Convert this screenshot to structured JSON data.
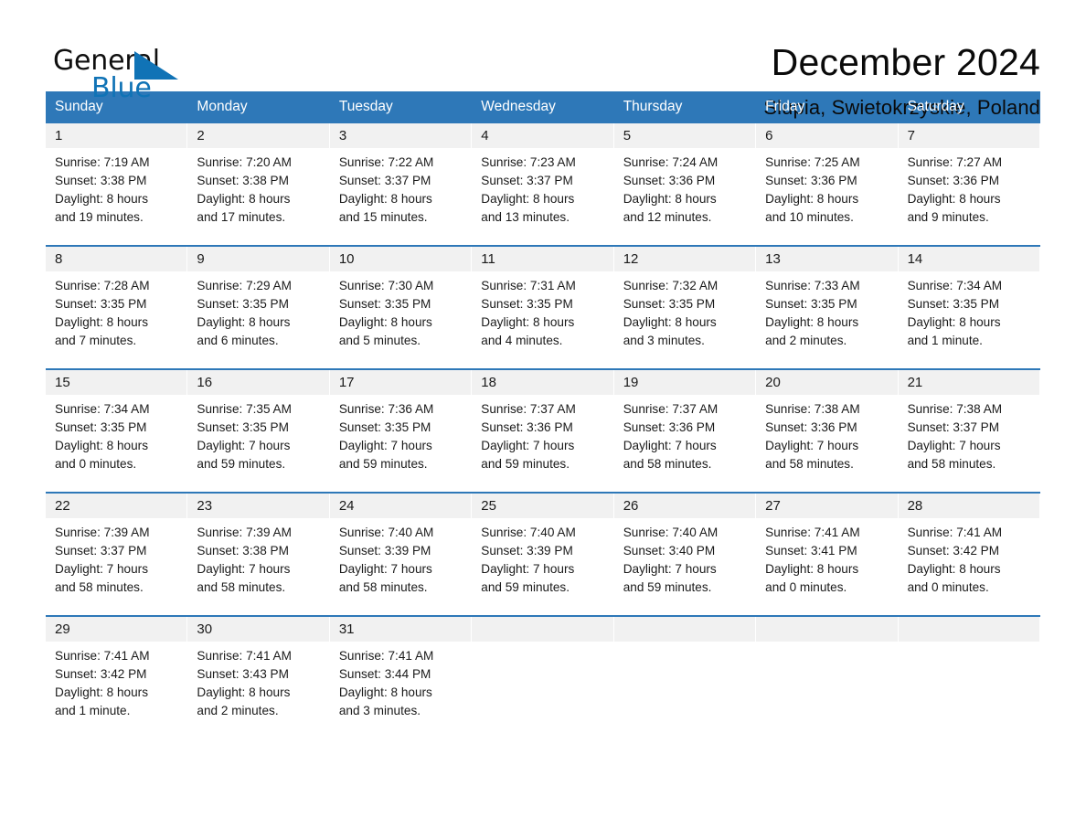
{
  "brand": {
    "name_part1": "General",
    "name_part2": "Blue",
    "accent_color": "#1073b6"
  },
  "header": {
    "month_title": "December 2024",
    "location": "Slupia, Swietokrzyskie, Poland"
  },
  "calendar": {
    "header_bg": "#2e78b8",
    "daynum_bg": "#f1f1f1",
    "weekdays": [
      "Sunday",
      "Monday",
      "Tuesday",
      "Wednesday",
      "Thursday",
      "Friday",
      "Saturday"
    ],
    "weeks": [
      [
        {
          "day": "1",
          "sunrise": "Sunrise: 7:19 AM",
          "sunset": "Sunset: 3:38 PM",
          "daylight_line1": "Daylight: 8 hours",
          "daylight_line2": "and 19 minutes."
        },
        {
          "day": "2",
          "sunrise": "Sunrise: 7:20 AM",
          "sunset": "Sunset: 3:38 PM",
          "daylight_line1": "Daylight: 8 hours",
          "daylight_line2": "and 17 minutes."
        },
        {
          "day": "3",
          "sunrise": "Sunrise: 7:22 AM",
          "sunset": "Sunset: 3:37 PM",
          "daylight_line1": "Daylight: 8 hours",
          "daylight_line2": "and 15 minutes."
        },
        {
          "day": "4",
          "sunrise": "Sunrise: 7:23 AM",
          "sunset": "Sunset: 3:37 PM",
          "daylight_line1": "Daylight: 8 hours",
          "daylight_line2": "and 13 minutes."
        },
        {
          "day": "5",
          "sunrise": "Sunrise: 7:24 AM",
          "sunset": "Sunset: 3:36 PM",
          "daylight_line1": "Daylight: 8 hours",
          "daylight_line2": "and 12 minutes."
        },
        {
          "day": "6",
          "sunrise": "Sunrise: 7:25 AM",
          "sunset": "Sunset: 3:36 PM",
          "daylight_line1": "Daylight: 8 hours",
          "daylight_line2": "and 10 minutes."
        },
        {
          "day": "7",
          "sunrise": "Sunrise: 7:27 AM",
          "sunset": "Sunset: 3:36 PM",
          "daylight_line1": "Daylight: 8 hours",
          "daylight_line2": "and 9 minutes."
        }
      ],
      [
        {
          "day": "8",
          "sunrise": "Sunrise: 7:28 AM",
          "sunset": "Sunset: 3:35 PM",
          "daylight_line1": "Daylight: 8 hours",
          "daylight_line2": "and 7 minutes."
        },
        {
          "day": "9",
          "sunrise": "Sunrise: 7:29 AM",
          "sunset": "Sunset: 3:35 PM",
          "daylight_line1": "Daylight: 8 hours",
          "daylight_line2": "and 6 minutes."
        },
        {
          "day": "10",
          "sunrise": "Sunrise: 7:30 AM",
          "sunset": "Sunset: 3:35 PM",
          "daylight_line1": "Daylight: 8 hours",
          "daylight_line2": "and 5 minutes."
        },
        {
          "day": "11",
          "sunrise": "Sunrise: 7:31 AM",
          "sunset": "Sunset: 3:35 PM",
          "daylight_line1": "Daylight: 8 hours",
          "daylight_line2": "and 4 minutes."
        },
        {
          "day": "12",
          "sunrise": "Sunrise: 7:32 AM",
          "sunset": "Sunset: 3:35 PM",
          "daylight_line1": "Daylight: 8 hours",
          "daylight_line2": "and 3 minutes."
        },
        {
          "day": "13",
          "sunrise": "Sunrise: 7:33 AM",
          "sunset": "Sunset: 3:35 PM",
          "daylight_line1": "Daylight: 8 hours",
          "daylight_line2": "and 2 minutes."
        },
        {
          "day": "14",
          "sunrise": "Sunrise: 7:34 AM",
          "sunset": "Sunset: 3:35 PM",
          "daylight_line1": "Daylight: 8 hours",
          "daylight_line2": "and 1 minute."
        }
      ],
      [
        {
          "day": "15",
          "sunrise": "Sunrise: 7:34 AM",
          "sunset": "Sunset: 3:35 PM",
          "daylight_line1": "Daylight: 8 hours",
          "daylight_line2": "and 0 minutes."
        },
        {
          "day": "16",
          "sunrise": "Sunrise: 7:35 AM",
          "sunset": "Sunset: 3:35 PM",
          "daylight_line1": "Daylight: 7 hours",
          "daylight_line2": "and 59 minutes."
        },
        {
          "day": "17",
          "sunrise": "Sunrise: 7:36 AM",
          "sunset": "Sunset: 3:35 PM",
          "daylight_line1": "Daylight: 7 hours",
          "daylight_line2": "and 59 minutes."
        },
        {
          "day": "18",
          "sunrise": "Sunrise: 7:37 AM",
          "sunset": "Sunset: 3:36 PM",
          "daylight_line1": "Daylight: 7 hours",
          "daylight_line2": "and 59 minutes."
        },
        {
          "day": "19",
          "sunrise": "Sunrise: 7:37 AM",
          "sunset": "Sunset: 3:36 PM",
          "daylight_line1": "Daylight: 7 hours",
          "daylight_line2": "and 58 minutes."
        },
        {
          "day": "20",
          "sunrise": "Sunrise: 7:38 AM",
          "sunset": "Sunset: 3:36 PM",
          "daylight_line1": "Daylight: 7 hours",
          "daylight_line2": "and 58 minutes."
        },
        {
          "day": "21",
          "sunrise": "Sunrise: 7:38 AM",
          "sunset": "Sunset: 3:37 PM",
          "daylight_line1": "Daylight: 7 hours",
          "daylight_line2": "and 58 minutes."
        }
      ],
      [
        {
          "day": "22",
          "sunrise": "Sunrise: 7:39 AM",
          "sunset": "Sunset: 3:37 PM",
          "daylight_line1": "Daylight: 7 hours",
          "daylight_line2": "and 58 minutes."
        },
        {
          "day": "23",
          "sunrise": "Sunrise: 7:39 AM",
          "sunset": "Sunset: 3:38 PM",
          "daylight_line1": "Daylight: 7 hours",
          "daylight_line2": "and 58 minutes."
        },
        {
          "day": "24",
          "sunrise": "Sunrise: 7:40 AM",
          "sunset": "Sunset: 3:39 PM",
          "daylight_line1": "Daylight: 7 hours",
          "daylight_line2": "and 58 minutes."
        },
        {
          "day": "25",
          "sunrise": "Sunrise: 7:40 AM",
          "sunset": "Sunset: 3:39 PM",
          "daylight_line1": "Daylight: 7 hours",
          "daylight_line2": "and 59 minutes."
        },
        {
          "day": "26",
          "sunrise": "Sunrise: 7:40 AM",
          "sunset": "Sunset: 3:40 PM",
          "daylight_line1": "Daylight: 7 hours",
          "daylight_line2": "and 59 minutes."
        },
        {
          "day": "27",
          "sunrise": "Sunrise: 7:41 AM",
          "sunset": "Sunset: 3:41 PM",
          "daylight_line1": "Daylight: 8 hours",
          "daylight_line2": "and 0 minutes."
        },
        {
          "day": "28",
          "sunrise": "Sunrise: 7:41 AM",
          "sunset": "Sunset: 3:42 PM",
          "daylight_line1": "Daylight: 8 hours",
          "daylight_line2": "and 0 minutes."
        }
      ],
      [
        {
          "day": "29",
          "sunrise": "Sunrise: 7:41 AM",
          "sunset": "Sunset: 3:42 PM",
          "daylight_line1": "Daylight: 8 hours",
          "daylight_line2": "and 1 minute."
        },
        {
          "day": "30",
          "sunrise": "Sunrise: 7:41 AM",
          "sunset": "Sunset: 3:43 PM",
          "daylight_line1": "Daylight: 8 hours",
          "daylight_line2": "and 2 minutes."
        },
        {
          "day": "31",
          "sunrise": "Sunrise: 7:41 AM",
          "sunset": "Sunset: 3:44 PM",
          "daylight_line1": "Daylight: 8 hours",
          "daylight_line2": "and 3 minutes."
        },
        {
          "day": "",
          "sunrise": "",
          "sunset": "",
          "daylight_line1": "",
          "daylight_line2": ""
        },
        {
          "day": "",
          "sunrise": "",
          "sunset": "",
          "daylight_line1": "",
          "daylight_line2": ""
        },
        {
          "day": "",
          "sunrise": "",
          "sunset": "",
          "daylight_line1": "",
          "daylight_line2": ""
        },
        {
          "day": "",
          "sunrise": "",
          "sunset": "",
          "daylight_line1": "",
          "daylight_line2": ""
        }
      ]
    ]
  }
}
